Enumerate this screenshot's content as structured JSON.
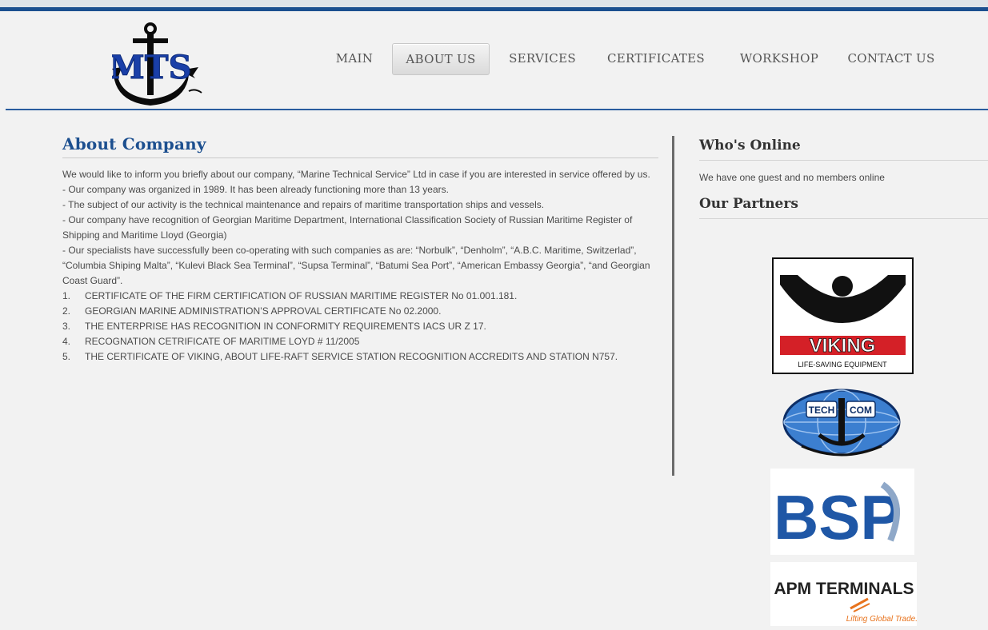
{
  "brand": {
    "logo_text": "MTS"
  },
  "nav": {
    "items": [
      {
        "label": "MAIN"
      },
      {
        "label": "ABOUT US"
      },
      {
        "label": "SERVICES"
      },
      {
        "label": "CERTIFICATES"
      },
      {
        "label": "WORKSHOP"
      },
      {
        "label": "CONTACT US"
      }
    ],
    "active": "ABOUT US"
  },
  "main": {
    "title": "About Company",
    "paragraphs": [
      "We would like to inform you briefly about our company, “Marine Technical Service” Ltd in case if you are interested in service offered by us.",
      "- Our company was organized in 1989. It has been already functioning more than 13 years.",
      " - The subject of our activity is the technical maintenance and repairs of maritime transportation ships and vessels.",
      " - Our company have recognition of Georgian Maritime Department, International Classification Society of Russian Maritime Register  of Shipping and Maritime Lloyd (Georgia)",
      "- Our specialists have successfully been co-operating with such companies as are: “Norbulk”, “Denholm”, “A.B.C. Maritime, Switzerlad”, “Columbia Shiping Malta”, “Kulevi Black Sea Terminal”, “Supsa Terminal”, “Batumi Sea Port”, “American Embassy Georgia”, “and Georgian Coast Guard”."
    ],
    "certificates": [
      {
        "num": "1.",
        "text": "CERTIFICATE OF THE FIRM CERTIFICATION OF RUSSIAN MARITIME REGISTER No 01.001.181."
      },
      {
        "num": "2.",
        "text": "GEORGIAN MARINE ADMINISTRATION’S APPROVAL CERTIFICATE No 02.2000."
      },
      {
        "num": "3.",
        "text": "THE ENTERPRISE HAS RECOGNITION IN CONFORMITY REQUIREMENTS IACS UR Z 17."
      },
      {
        "num": "4.",
        "text": "RECOGNATION CETRIFICATE OF MARITIME LOYD # 11/2005"
      },
      {
        "num": "5.",
        "text": "THE CERTIFICATE OF VIKING, ABOUT LIFE-RAFT SERVICE STATION RECOGNITION ACCREDITS AND STATION N757."
      }
    ]
  },
  "sidebar": {
    "online_title": "Who's Online",
    "online_text": "We have one guest and no members online",
    "partners_title": "Our Partners",
    "partners": {
      "viking": {
        "name": "VIKING",
        "tagline": "LIFE-SAVING EQUIPMENT"
      },
      "techcom": {
        "left": "TECH",
        "right": "COM"
      },
      "bsp": {
        "name": "BSP"
      },
      "apm": {
        "name": "APM TERMINALS",
        "tagline": "Lifting Global Trade."
      }
    }
  },
  "colors": {
    "accent": "#1c4f8f",
    "background": "#f2f2f2",
    "viking_red": "#d42027",
    "bsp_blue": "#1f57a6",
    "apm_orange": "#e8731d"
  }
}
